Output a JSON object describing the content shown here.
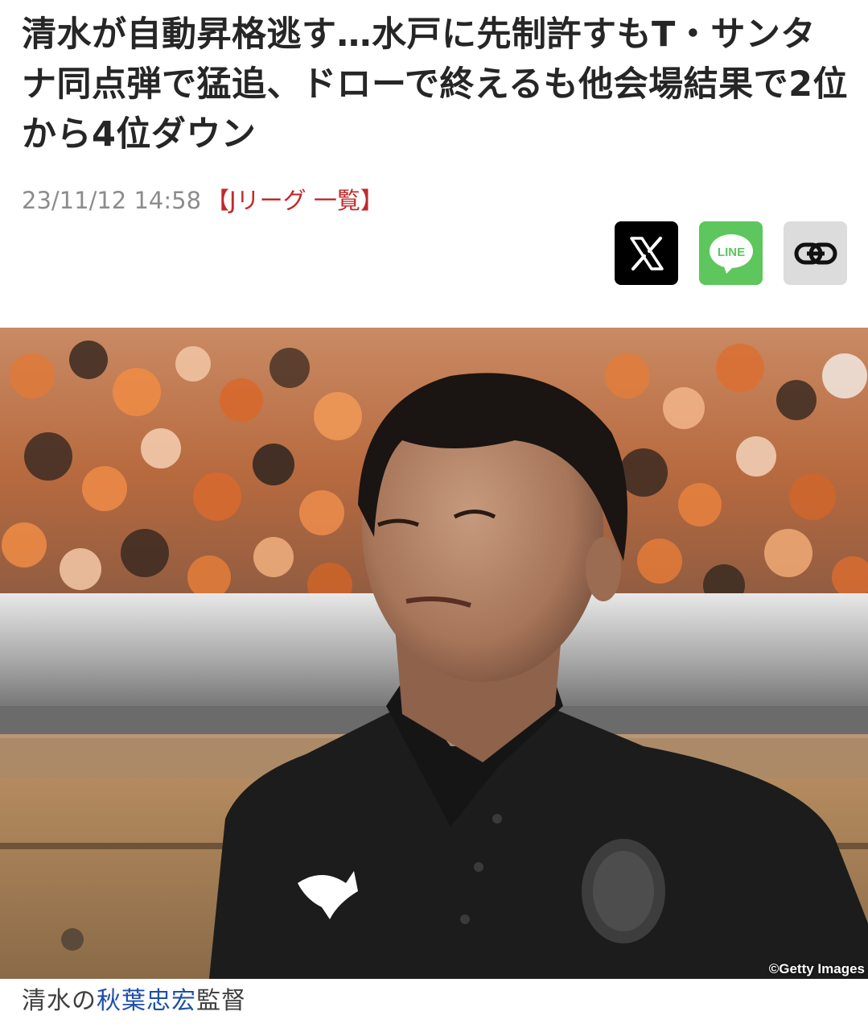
{
  "article": {
    "headline": "清水が自動昇格逃す…水戸に先制許すもT・サンタナ同点弾で猛追、ドローで終えるも他会場結果で2位から4位ダウン",
    "date": "23/11/12 14:58",
    "category": "【Jリーグ 一覧】"
  },
  "share": {
    "x_label": "X",
    "line_label": "LINE",
    "link_icon": "link-icon",
    "colors": {
      "x": "#000000",
      "line": "#5dc65d",
      "link": "#dcdcdc"
    }
  },
  "photo": {
    "credit": "©Getty Images"
  },
  "caption": {
    "prefix": "清水の",
    "name": "秋葉忠宏",
    "suffix": "監督"
  },
  "colors": {
    "headline": "#262626",
    "date": "#8c8c8c",
    "category": "#c12a2a",
    "caption_link": "#1f4fa8"
  }
}
